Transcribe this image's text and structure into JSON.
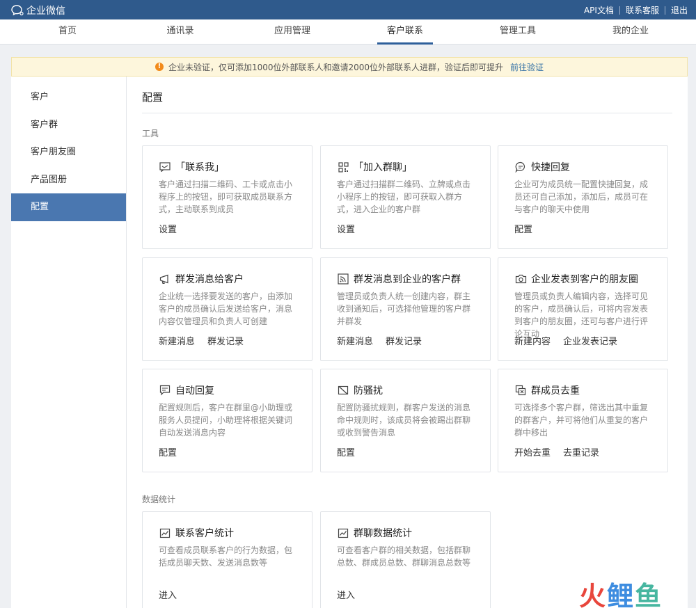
{
  "app": {
    "brand": "企业微信",
    "top_links": [
      "API文档",
      "联系客服",
      "退出"
    ]
  },
  "nav": {
    "tabs": [
      "首页",
      "通讯录",
      "应用管理",
      "客户联系",
      "管理工具",
      "我的企业"
    ],
    "active_index": 3
  },
  "notice": {
    "text": "企业未验证，仅可添加1000位外部联系人和邀请2000位外部联系人进群，验证后即可提升",
    "link": "前往验证"
  },
  "sidebar": {
    "items": [
      "客户",
      "客户群",
      "客户朋友圈",
      "产品图册",
      "配置"
    ],
    "active_index": 4
  },
  "main": {
    "title": "配置",
    "sections": [
      {
        "label": "工具",
        "cards": [
          {
            "icon": "message-icon",
            "title": "「联系我」",
            "desc": "客户通过扫描二维码、工卡或点击小程序上的按钮，即可获取成员联系方式，主动联系到成员",
            "actions": [
              "设置"
            ]
          },
          {
            "icon": "qrcode-icon",
            "title": "「加入群聊」",
            "desc": "客户通过扫描群二维码、立牌或点击小程序上的按钮，即可获取入群方式，进入企业的客户群",
            "actions": [
              "设置"
            ]
          },
          {
            "icon": "chat-bubble-icon",
            "title": "快捷回复",
            "desc": "企业可为成员统一配置快捷回复，成员还可自己添加，添加后，成员可在与客户的聊天中使用",
            "actions": [
              "配置"
            ]
          },
          {
            "icon": "megaphone-icon",
            "title": "群发消息给客户",
            "desc": "企业统一选择要发送的客户，由添加客户的成员确认后发送给客户，消息内容仅管理员和负责人可创建",
            "actions": [
              "新建消息",
              "群发记录"
            ]
          },
          {
            "icon": "broadcast-icon",
            "title": "群发消息到企业的客户群",
            "desc": "管理员或负责人统一创建内容，群主收到通知后，可选择他管理的客户群并群发",
            "actions": [
              "新建消息",
              "群发记录"
            ]
          },
          {
            "icon": "camera-icon",
            "title": "企业发表到客户的朋友圈",
            "desc": "管理员或负责人编辑内容，选择可见的客户，成员确认后，可将内容发表到客户的朋友圈，还可与客户进行评论互动",
            "actions": [
              "新建内容",
              "企业发表记录"
            ]
          },
          {
            "icon": "auto-reply-icon",
            "title": "自动回复",
            "desc": "配置规则后，客户在群里@小助理或服务人员提问，小助理将根据关键词自动发送消息内容",
            "actions": [
              "配置"
            ]
          },
          {
            "icon": "shield-icon",
            "title": "防骚扰",
            "desc": "配置防骚扰规则，群客户发送的消息命中规则时，该成员将会被踢出群聊或收到警告消息",
            "actions": [
              "配置"
            ]
          },
          {
            "icon": "dedupe-icon",
            "title": "群成员去重",
            "desc": "可选择多个客户群，筛选出其中重复的群客户，并可将他们从重复的客户群中移出",
            "actions": [
              "开始去重",
              "去重记录"
            ]
          }
        ]
      },
      {
        "label": "数据统计",
        "cards": [
          {
            "icon": "line-chart-icon",
            "title": "联系客户统计",
            "desc": "可查看成员联系客户的行为数据，包括成员聊天数、发送消息数等",
            "actions": [
              "进入"
            ]
          },
          {
            "icon": "line-chart-icon",
            "title": "群聊数据统计",
            "desc": "可查看客户群的相关数据，包括群聊总数、群成员总数、群聊消息总数等",
            "actions": [
              "进入"
            ]
          }
        ]
      }
    ]
  },
  "watermark": [
    "火",
    "鲤",
    "鱼"
  ]
}
